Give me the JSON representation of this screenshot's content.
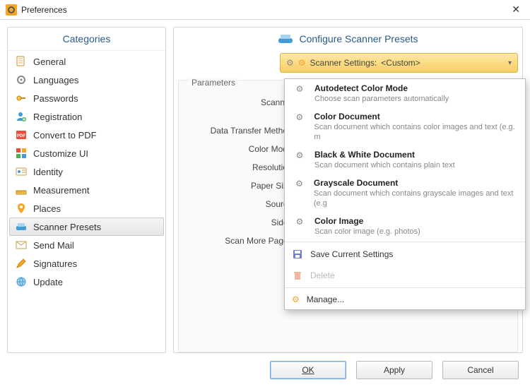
{
  "window": {
    "title": "Preferences"
  },
  "categories": {
    "header": "Categories",
    "items": [
      {
        "label": "General"
      },
      {
        "label": "Languages"
      },
      {
        "label": "Passwords"
      },
      {
        "label": "Registration"
      },
      {
        "label": "Convert to PDF"
      },
      {
        "label": "Customize UI"
      },
      {
        "label": "Identity"
      },
      {
        "label": "Measurement"
      },
      {
        "label": "Places"
      },
      {
        "label": "Scanner Presets"
      },
      {
        "label": "Send Mail"
      },
      {
        "label": "Signatures"
      },
      {
        "label": "Update"
      }
    ],
    "selected_index": 9
  },
  "right": {
    "header": "Configure Scanner Presets",
    "settings_bar": {
      "label": "Scanner Settings:",
      "value": "<Custom>"
    },
    "parameters": {
      "legend": "Parameters",
      "rows": [
        "Scanner:",
        "Data Transfer Method:",
        "Color Mode:",
        "Resolution:",
        "Paper Size:",
        "Source:",
        "Sides:",
        "Scan More Pages:"
      ]
    }
  },
  "dropdown": {
    "presets": [
      {
        "title": "Autodetect Color Mode",
        "desc": "Choose scan parameters automatically"
      },
      {
        "title": "Color Document",
        "desc": "Scan document which contains color images and text (e.g. m"
      },
      {
        "title": "Black & White Document",
        "desc": "Scan document which contains plain text"
      },
      {
        "title": "Grayscale Document",
        "desc": "Scan document which contains grayscale images and text (e.g"
      },
      {
        "title": "Color Image",
        "desc": "Scan color image (e.g. photos)"
      }
    ],
    "actions": {
      "save": "Save Current Settings",
      "delete": "Delete",
      "manage": "Manage..."
    }
  },
  "footer": {
    "ok": "OK",
    "apply": "Apply",
    "cancel": "Cancel"
  }
}
